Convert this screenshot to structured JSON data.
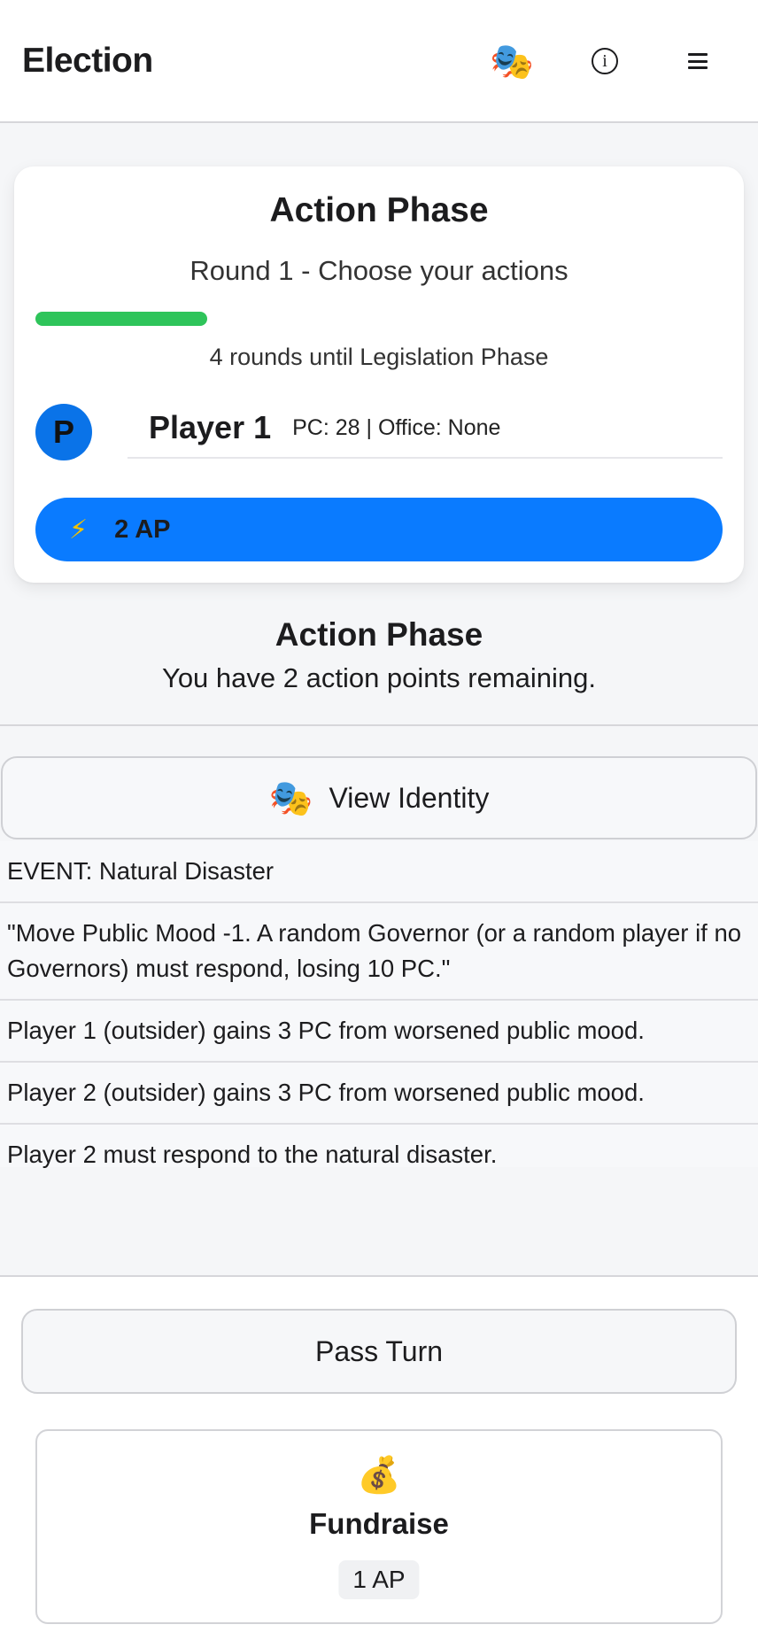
{
  "header": {
    "title": "Election",
    "identity_icon": "🎭",
    "info_icon": "i",
    "menu_icon": "hamburger-menu"
  },
  "phase_card": {
    "title": "Action Phase",
    "subtitle": "Round 1 - Choose your actions",
    "progress_fraction": 0.25,
    "progress_color": "#2ec45a",
    "rounds_text": "4 rounds until Legislation Phase",
    "player": {
      "avatar_letter": "P",
      "name": "Player 1",
      "stats": "PC: 28 | Office: None"
    },
    "ap": {
      "icon": "⚡",
      "label": "2 AP",
      "color": "#0a7bff"
    }
  },
  "action": {
    "heading": "Action Phase",
    "description": "You have 2 action points remaining."
  },
  "identity_button": {
    "icon": "🎭",
    "label": "View Identity"
  },
  "event_log": [
    "EVENT: Natural Disaster",
    "\"Move Public Mood -1. A random Governor (or a random player if no Governors) must respond, losing 10 PC.\"",
    "Player 1 (outsider) gains 3 PC from worsened public mood.",
    "Player 2 (outsider) gains 3 PC from worsened public mood.",
    "Player 2 must respond to the natural disaster."
  ],
  "footer": {
    "pass_label": "Pass Turn",
    "fundraise": {
      "icon": "💰",
      "title": "Fundraise",
      "cost": "1 AP"
    }
  }
}
